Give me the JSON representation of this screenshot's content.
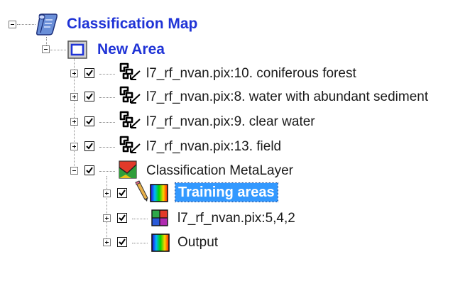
{
  "tree": {
    "root": {
      "label": "Classification Map",
      "icon": "map-scroll-icon",
      "expanded": true
    },
    "area": {
      "label": "New Area",
      "icon": "area-frame-icon",
      "expanded": true
    },
    "vectors": [
      {
        "label": "l7_rf_nvan.pix:10. coniferous forest",
        "checked": true,
        "icon": "vector-layer-icon"
      },
      {
        "label": "l7_rf_nvan.pix:8. water with abundant sediment",
        "checked": true,
        "icon": "vector-layer-icon"
      },
      {
        "label": "l7_rf_nvan.pix:9. clear water",
        "checked": true,
        "icon": "vector-layer-icon"
      },
      {
        "label": "l7_rf_nvan.pix:13. field",
        "checked": true,
        "icon": "vector-layer-icon"
      }
    ],
    "metalayer": {
      "label": "Classification MetaLayer",
      "checked": true,
      "icon": "metalayer-icon",
      "expanded": true
    },
    "children": [
      {
        "label": "Training areas",
        "checked": true,
        "icon": "pseudocolor-icon",
        "editing": true,
        "selected": true
      },
      {
        "label": "l7_rf_nvan.pix:5,4,2",
        "checked": true,
        "icon": "rgb-layer-icon"
      },
      {
        "label": "Output",
        "checked": true,
        "icon": "pseudocolor-icon"
      }
    ]
  },
  "colors": {
    "root_text": "#1f33d6",
    "selection_bg": "#3399ff",
    "selection_text": "#ffffff"
  }
}
